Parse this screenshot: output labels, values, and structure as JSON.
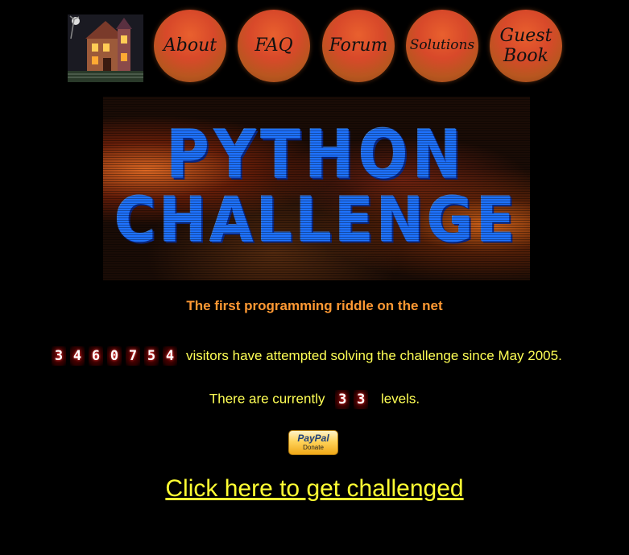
{
  "nav": {
    "items": [
      {
        "label": "About"
      },
      {
        "label": "FAQ"
      },
      {
        "label": "Forum"
      },
      {
        "label": "Solutions"
      },
      {
        "label": "Guest"
      },
      {
        "label": "Book"
      }
    ]
  },
  "banner": {
    "line1": "PYTHON",
    "line2": "CHALLENGE"
  },
  "tagline": "The first programming riddle on the net",
  "visitors": {
    "digits": [
      "3",
      "4",
      "6",
      "0",
      "7",
      "5",
      "4"
    ],
    "text": "visitors have attempted solving the challenge since May 2005."
  },
  "levels": {
    "prefix": "There are currently",
    "digits": [
      "3",
      "3"
    ],
    "suffix": "levels."
  },
  "donate": {
    "logo": "PayPal",
    "label": "Donate"
  },
  "challenge_link": "Click here to get challenged",
  "colors": {
    "background": "#000000",
    "tagline": "#ff9933",
    "body_text": "#ffff55",
    "link": "#ffff33",
    "button": "#d8492a"
  }
}
